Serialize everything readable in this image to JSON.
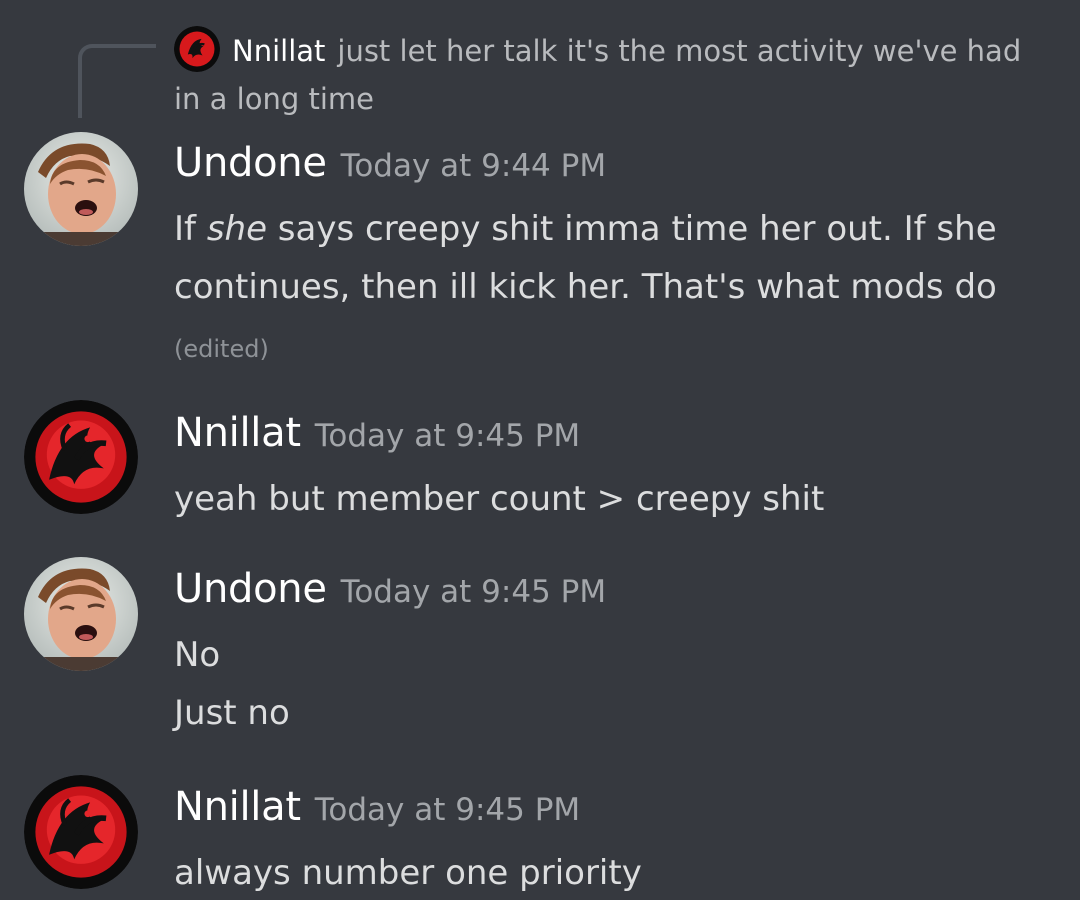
{
  "reply": {
    "author": "Nnillat",
    "text": "just let her talk it's the most activity we've had in a long time"
  },
  "messages": [
    {
      "author": "Undone",
      "timestamp": "Today at 9:44 PM",
      "text_before": "If ",
      "text_em": "she",
      "text_after": " says creepy shit imma time her out. If she continues, then ill kick her. That's what mods do",
      "edited": "(edited)"
    },
    {
      "author": "Nnillat",
      "timestamp": "Today at 9:45 PM",
      "lines": [
        "yeah but member count > creepy shit"
      ]
    },
    {
      "author": "Undone",
      "timestamp": "Today at 9:45 PM",
      "lines": [
        "No",
        "Just no"
      ]
    },
    {
      "author": "Nnillat",
      "timestamp": "Today at 9:45 PM",
      "lines": [
        "always number one priority"
      ]
    }
  ],
  "colors": {
    "background": "#36393f",
    "username": "#ffffff",
    "timestamp": "#a3a6aa",
    "text": "#dcddde",
    "sigil_red": "#d7191c"
  },
  "icons": {
    "nnillat_avatar": "red-dragon-sigil-icon",
    "undone_avatar": "user-photo-avatar"
  }
}
